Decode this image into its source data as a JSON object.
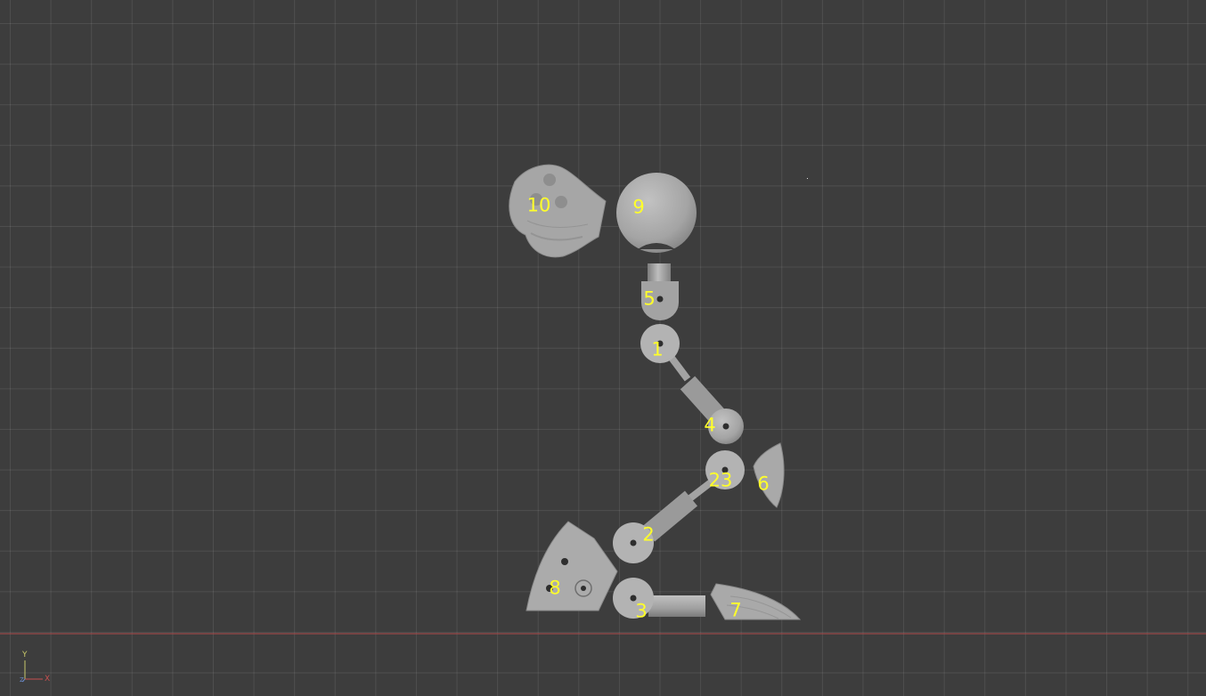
{
  "viewport": {
    "background_color": "#3d3d3d",
    "grid_color": "#505050",
    "x_axis_line_color": "#b04a4a",
    "part_color": "#a9a9a9",
    "label_color": "#ffff2a"
  },
  "part_labels": {
    "p1": "1",
    "p2": "2",
    "p3": "3",
    "p4": "4",
    "p5": "5",
    "p6": "6",
    "p7": "7",
    "p8": "8",
    "p9": "9",
    "p10": "10",
    "p23": "23"
  },
  "axis_gizmo": {
    "y_label": "Y",
    "x_label": "X",
    "z_label": "Z",
    "y_color": "#c8c86a",
    "x_color": "#c85050",
    "z_color": "#6a8ac8"
  }
}
